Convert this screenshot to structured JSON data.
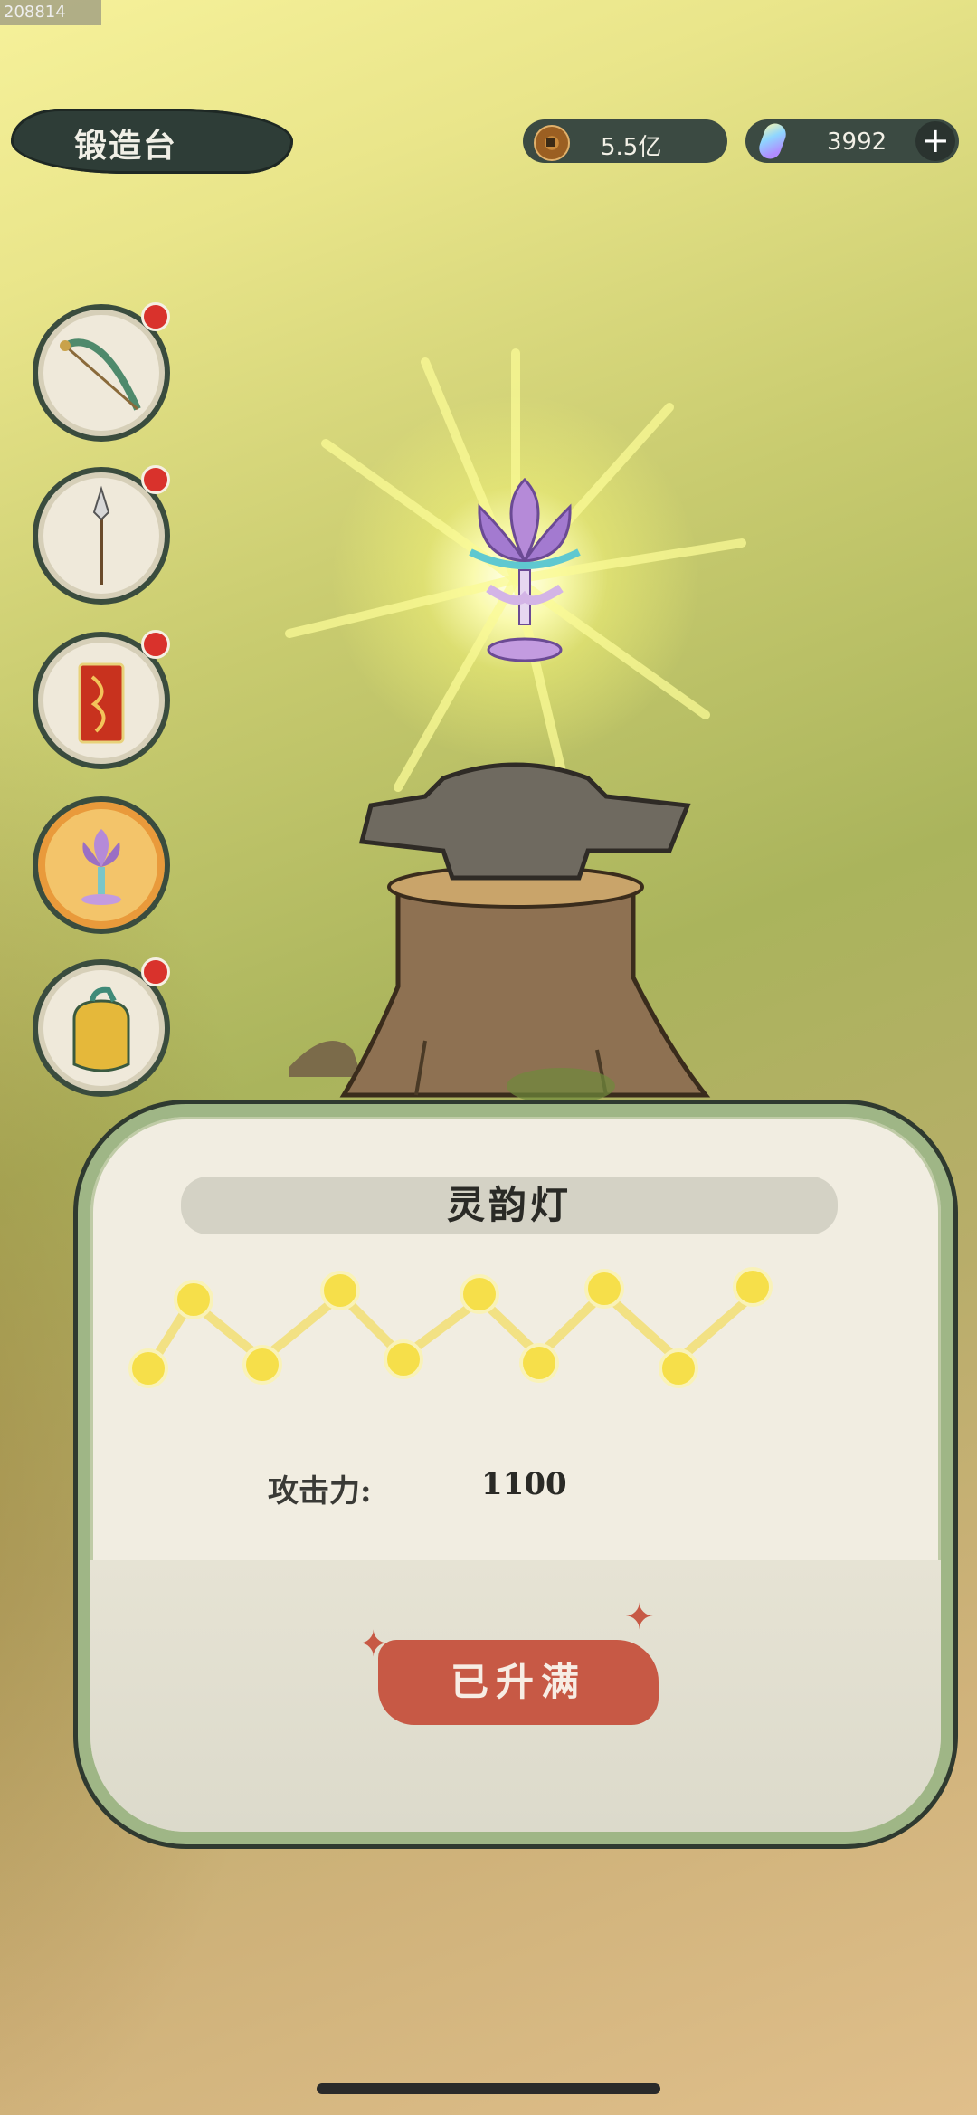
{
  "debug_id": "208814",
  "header": {
    "title": "锻造台",
    "copper": "5.5亿",
    "gems": "3992",
    "plus_label": "+"
  },
  "slots": [
    {
      "name": "bow",
      "badge": true
    },
    {
      "name": "spear",
      "badge": true
    },
    {
      "name": "talisman",
      "badge": true
    },
    {
      "name": "lotus-lamp",
      "badge": false,
      "selected": true
    },
    {
      "name": "jar",
      "badge": true
    }
  ],
  "item": {
    "name": "灵韵灯",
    "stars_total": 10,
    "stars_filled": 10,
    "stat_label": "攻击力:",
    "stat_value": "1100",
    "button_label": "已升满"
  },
  "colors": {
    "panel_border": "#9fb686",
    "button": "#c75945",
    "badge": "#d9322c",
    "selected_slot": "#f3c46a"
  }
}
